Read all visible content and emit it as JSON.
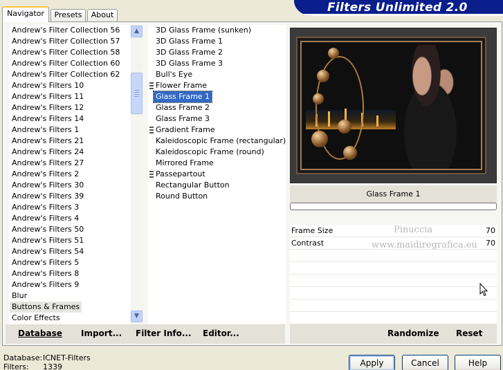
{
  "app": {
    "title": "Filters Unlimited 2.0"
  },
  "tabs": [
    {
      "label": "Navigator",
      "active": true
    },
    {
      "label": "Presets",
      "active": false
    },
    {
      "label": "About",
      "active": false
    }
  ],
  "categories": {
    "selected": "Buttons & Frames",
    "items": [
      "Andrew's Filter Collection 56",
      "Andrew's Filter Collection 57",
      "Andrew's Filter Collection 58",
      "Andrew's Filter Collection 60",
      "Andrew's Filter Collection 62",
      "Andrew's Filters 10",
      "Andrew's Filters 11",
      "Andrew's Filters 12",
      "Andrew's Filters 14",
      "Andrew's Filters 1",
      "Andrew's Filters 21",
      "Andrew's Filters 24",
      "Andrew's Filters 27",
      "Andrew's Filters 2",
      "Andrew's Filters 30",
      "Andrew's Filters 39",
      "Andrew's Filters 3",
      "Andrew's Filters 4",
      "Andrew's Filters 50",
      "Andrew's Filters 51",
      "Andrew's Filters 54",
      "Andrew's Filters 5",
      "Andrew's Filters 8",
      "Andrew's Filters 9",
      "Blur",
      "Buttons & Frames",
      "Color Effects"
    ]
  },
  "filters": {
    "selected": "Glass Frame 1",
    "items": [
      {
        "label": "3D Glass Frame (sunken)",
        "marker": false
      },
      {
        "label": "3D Glass Frame 1",
        "marker": false
      },
      {
        "label": "3D Glass Frame 2",
        "marker": false
      },
      {
        "label": "3D Glass Frame 3",
        "marker": false
      },
      {
        "label": "Bull's Eye",
        "marker": false
      },
      {
        "label": "Flower Frame",
        "marker": true
      },
      {
        "label": "Glass Frame 1",
        "marker": false
      },
      {
        "label": "Glass Frame 2",
        "marker": false
      },
      {
        "label": "Glass Frame 3",
        "marker": false
      },
      {
        "label": "Gradient Frame",
        "marker": true
      },
      {
        "label": "Kaleidoscopic Frame (rectangular)",
        "marker": false
      },
      {
        "label": "Kaleidoscopic Frame (round)",
        "marker": false
      },
      {
        "label": "Mirrored Frame",
        "marker": false
      },
      {
        "label": "Passepartout",
        "marker": true
      },
      {
        "label": "Rectangular Button",
        "marker": false
      },
      {
        "label": "Round Button",
        "marker": false
      }
    ]
  },
  "preview": {
    "caption": "Glass Frame 1",
    "progress": 0
  },
  "params": [
    {
      "name": "Frame Size",
      "value": "70"
    },
    {
      "name": "Contrast",
      "value": "70"
    }
  ],
  "watermark": {
    "line1": "Pinuccia",
    "line2": "www.maidiregrafica.eu"
  },
  "toolbar": {
    "database": "Database",
    "import": "Import...",
    "filter_info": "Filter Info...",
    "editor": "Editor...",
    "randomize": "Randomize",
    "reset": "Reset"
  },
  "status": {
    "database_label": "Database:",
    "database_value": "ICNET-Filters",
    "filters_label": "Filters:",
    "filters_value": "1339"
  },
  "buttons": {
    "apply": "Apply",
    "cancel": "Cancel",
    "help": "Help"
  },
  "colors": {
    "banner": "#0a1e8c",
    "selection": "#316ac5",
    "window": "#ece9d8"
  }
}
